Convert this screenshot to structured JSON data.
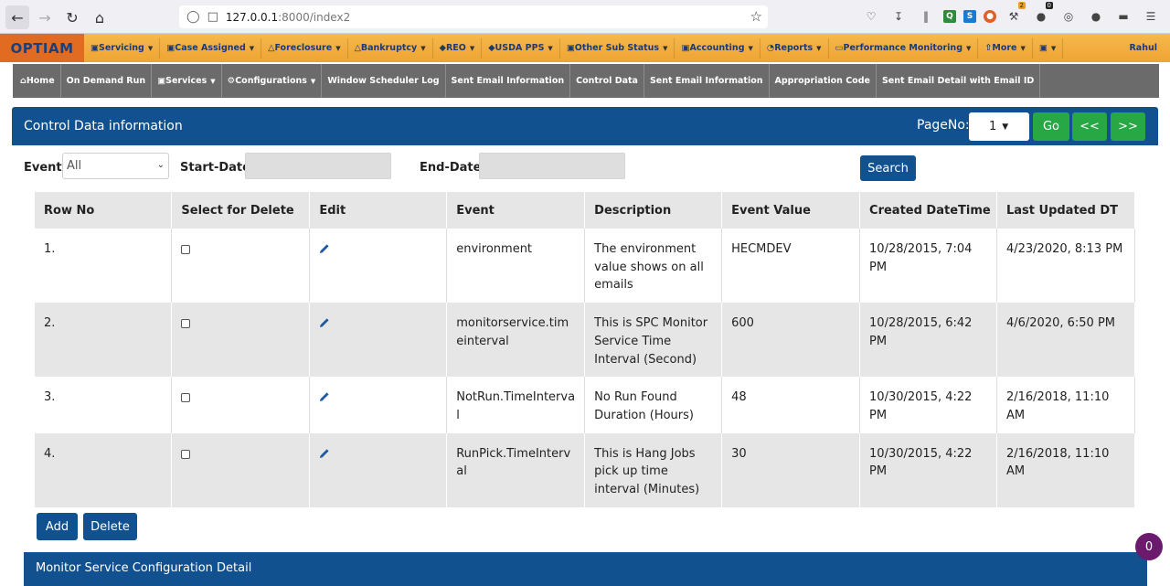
{
  "browser": {
    "url_host": "127.0.0.1",
    "url_path": ":8000/index2",
    "ext_badge_1": "2",
    "ext_badge_2": "0",
    "ext_q": "Q",
    "ext_s": "S"
  },
  "topnav": {
    "brand": "OPTIAM",
    "items": [
      "Servicing",
      "Case Assigned",
      "Foreclosure",
      "Bankruptcy",
      "REO",
      "USDA PPS",
      "Other Sub Status",
      "Accounting",
      "Reports",
      "Performance Monitoring",
      "More",
      ""
    ],
    "user": "Rahul"
  },
  "subnav": {
    "items": [
      "Home",
      "On Demand Run",
      "Services",
      "Configurations",
      "Window Scheduler Log",
      "Sent Email Information",
      "Control Data",
      "Sent Email Information",
      "Appropriation Code",
      "Sent Email Detail with Email ID"
    ]
  },
  "panel": {
    "title": "Control Data information",
    "pageno_label": "PageNo:",
    "pageno_value": "1",
    "go": "Go",
    "prev": "<<",
    "next": ">>"
  },
  "filters": {
    "event_label": "Event:",
    "event_value": "All",
    "start_label": "Start-Date:",
    "end_label": "End-Date:",
    "search": "Search"
  },
  "table": {
    "headers": [
      "Row No",
      "Select for Delete",
      "Edit",
      "Event",
      "Description",
      "Event Value",
      "Created DateTime",
      "Last Updated DT"
    ],
    "rows": [
      {
        "row_no": "1.",
        "event": "environment",
        "description": "The environment value shows on all emails",
        "value": "HECMDEV",
        "created": "10/28/2015, 7:04 PM",
        "updated": "4/23/2020, 8:13 PM"
      },
      {
        "row_no": "2.",
        "event": "monitorservice.timeinterval",
        "description": "This is SPC Monitor Service Time Interval (Second)",
        "value": "600",
        "created": "10/28/2015, 6:42 PM",
        "updated": "4/6/2020, 6:50 PM"
      },
      {
        "row_no": "3.",
        "event": "NotRun.TimeInterval",
        "description": "No Run Found Duration (Hours)",
        "value": "48",
        "created": "10/30/2015, 4:22 PM",
        "updated": "2/16/2018, 11:10 AM"
      },
      {
        "row_no": "4.",
        "event": "RunPick.TimeInterval",
        "description": "This is Hang Jobs pick up time interval (Minutes)",
        "value": "30",
        "created": "10/30/2015, 4:22 PM",
        "updated": "2/16/2018, 11:10 AM"
      }
    ]
  },
  "actions": {
    "add": "Add",
    "delete": "Delete"
  },
  "bottom_panel": {
    "title": "Monitor Service Configuration Detail"
  },
  "float_badge": "0"
}
